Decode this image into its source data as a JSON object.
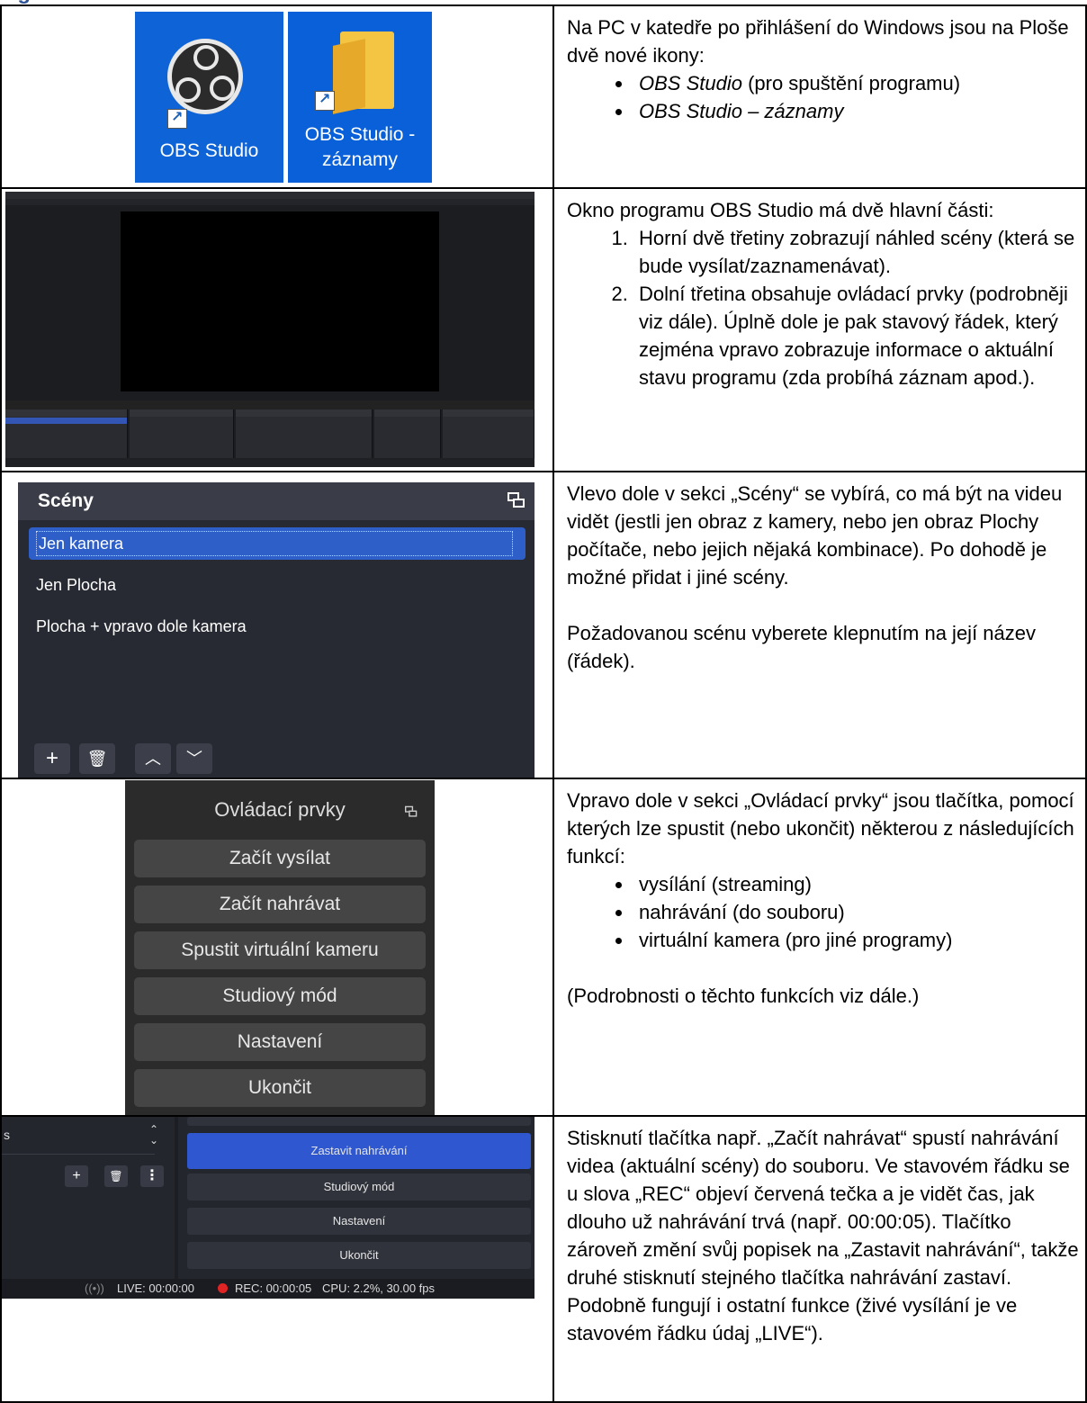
{
  "row1": {
    "icon1_label": "OBS Studio",
    "icon2_label_line1": "OBS Studio -",
    "icon2_label_line2": "záznamy",
    "text_intro": "Na PC v katedře po přihlášení do Windows jsou na Ploše dvě nové ikony:",
    "bullet1_em": "OBS Studio",
    "bullet1_rest": " (pro spuštění programu)",
    "bullet2_em": "OBS Studio – záznamy"
  },
  "row2": {
    "text_intro": "Okno programu OBS Studio má dvě hlavní části:",
    "item1": "Horní dvě třetiny zobrazují náhled scény (která se bude vysílat/zaznamenávat).",
    "item2": "Dolní třetina obsahuje ovládací prvky (podrobněji viz dále). Úplně dole je pak stavový řádek, který zejména vpravo zobrazuje informace o aktuální stavu programu (zda probíhá záznam apod.)."
  },
  "row3": {
    "panel_title": "Scény",
    "scenes": [
      "Jen kamera",
      "Jen Plocha",
      "Plocha + vpravo dole kamera"
    ],
    "text1": "Vlevo dole v sekci „Scény“ se vybírá, co má být na videu vidět (jestli jen obraz z kamery, nebo jen obraz Plochy počítače, nebo jejich nějaká kombinace). Po dohodě je možné přidat i jiné scény.",
    "text2": "Požadovanou scénu vyberete klepnutím na její název (řádek)."
  },
  "row4": {
    "panel_title": "Ovládací prvky",
    "buttons": [
      "Začít vysílat",
      "Začít nahrávat",
      "Spustit virtuální kameru",
      "Studiový mód",
      "Nastavení",
      "Ukončit"
    ],
    "text_intro": "Vpravo dole v sekci „Ovládací prvky“ jsou tlačítka, pomocí kterých lze spustit (nebo ukončit) některou z následujících funkcí:",
    "bullets": [
      "vysílání (streaming)",
      "nahrávání (do souboru)",
      "virtuální kamera (pro jiné programy)"
    ],
    "text_after": "(Podrobnosti o těchto funkcích viz dále.)"
  },
  "row5": {
    "stop_button": "Zastavit nahrávání",
    "buttons": [
      "Studiový mód",
      "Nastavení",
      "Ukončit"
    ],
    "status_live": "LIVE: 00:00:00",
    "status_rec": "REC: 00:00:05",
    "status_cpu": "CPU: 2.2%, 30.00 fps",
    "text": "Stisknutí tlačítka např. „Začít nahrávat“ spustí nahrávání videa (aktuální scény) do souboru. Ve stavovém řádku se u slova „REC“ objeví červená tečka a je vidět čas, jak dlouho už nahrávání trvá (např. 00:00:05). Tlačítko zároveň změní svůj popisek na „Zastavit nahrávání“, takže druhé stisknutí stejného tlačítka nahrávání zastaví. Podobně fungují i ostatní funkce (živé vysílání je ve stavovém řádku údaj „LIVE“)."
  }
}
